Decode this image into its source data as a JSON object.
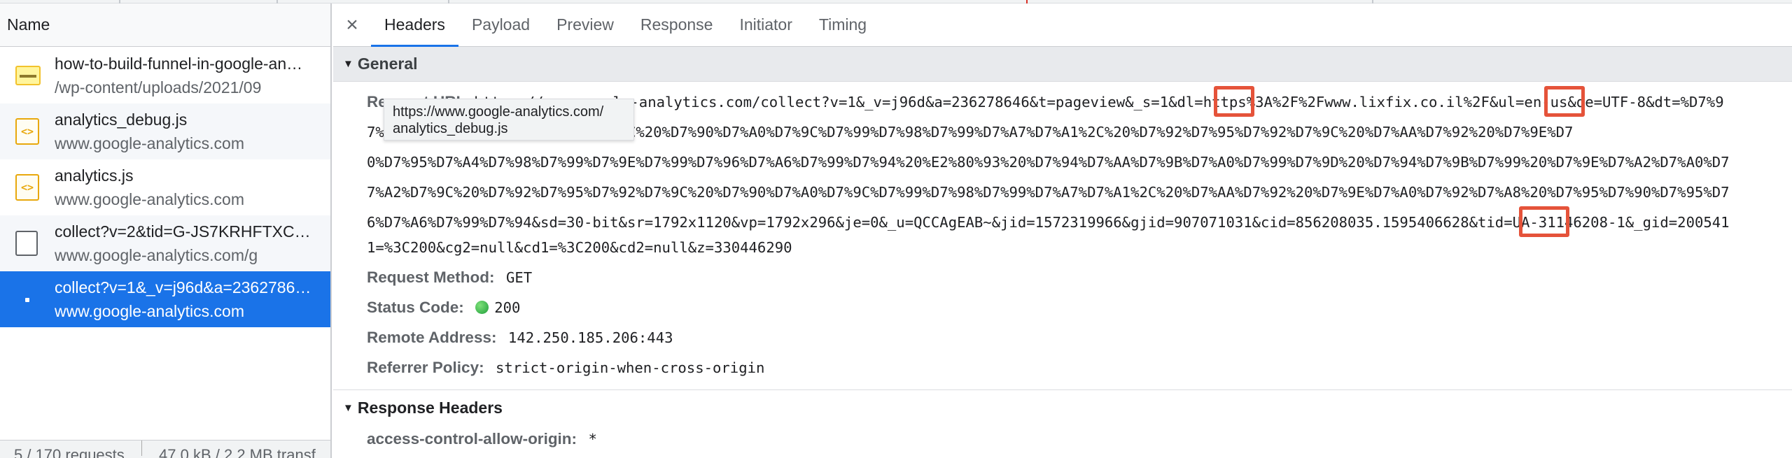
{
  "left_panel": {
    "column_header": "Name",
    "requests": [
      {
        "name": "how-to-build-funnel-in-google-an…",
        "path": "/wp-content/uploads/2021/09",
        "icon": "image-icon"
      },
      {
        "name": "analytics_debug.js",
        "path": "www.google-analytics.com",
        "icon": "script-icon"
      },
      {
        "name": "analytics.js",
        "path": "www.google-analytics.com",
        "icon": "script-icon"
      },
      {
        "name": "collect?v=2&tid=G-JS7KRHFTXC…",
        "path": "www.google-analytics.com/g",
        "icon": "document-icon"
      },
      {
        "name": "collect?v=1&_v=j96d&a=2362786…",
        "path": "www.google-analytics.com",
        "icon": "request-icon",
        "selected": true
      }
    ],
    "status": {
      "requests": "5 / 170 requests",
      "transfer": "47.0 kB / 2.2 MB transf"
    }
  },
  "tabs": {
    "items": [
      "Headers",
      "Payload",
      "Preview",
      "Response",
      "Initiator",
      "Timing"
    ],
    "active": "Headers"
  },
  "general": {
    "title": "General",
    "request_url_label": "Request URL:",
    "url_lines": [
      "https://www.google-analytics.com/collect?v=1&_v=j96d&a=236278646&t=pageview&_s=1&dl=https%3A%2F%2Fwww.lixfix.co.il%2F&ul=en-us&de=UTF-8&dt=%D7%9",
      "7%D7%95%D7%92%D7%95%D7%92%D7%9C%20%D7%90%D7%A0%D7%9C%D7%99%D7%98%D7%99%D7%A7%D7%A1%2C%20%D7%92%D7%95%D7%92%D7%9C%20%D7%AA%D7%92%20%D7%9E%D7",
      "0%D7%95%D7%A4%D7%98%D7%99%D7%9E%D7%99%D7%96%D7%A6%D7%99%D7%94%20%E2%80%93%20%D7%94%D7%AA%D7%9B%D7%A0%D7%99%D7%9D%20%D7%94%D7%9B%D7%99%20%D7%9E%D7%A2%D7%A0%D7",
      "7%A2%D7%9C%20%D7%92%D7%95%D7%92%D7%9C%20%D7%90%D7%A0%D7%9C%D7%99%D7%98%D7%99%D7%A7%D7%A1%2C%20%D7%AA%D7%92%20%D7%9E%D7%A0%D7%92%D7%A8%20%D7%95%D7%90%D7%95%D7",
      "6%D7%A6%D7%99%D7%94&sd=30-bit&sr=1792x1120&vp=1792x296&je=0&_u=QCCAgEAB~&jid=1572319966&gjid=907071031&cid=856208035.1595406628&tid=UA-31146208-1&_gid=200541",
      "1=%3C200&cg2=null&cd1=%3C200&cd2=null&z=330446290"
    ],
    "tooltip": {
      "line1": "https://www.google-analytics.com/",
      "line2": "analytics_debug.js"
    },
    "request_method_label": "Request Method:",
    "request_method": "GET",
    "status_code_label": "Status Code:",
    "status_code": "200",
    "status_color": "#1e9e3a",
    "remote_address_label": "Remote Address:",
    "remote_address": "142.250.185.206:443",
    "referrer_policy_label": "Referrer Policy:",
    "referrer_policy": "strict-origin-when-cross-origin"
  },
  "response_headers": {
    "title": "Response Headers",
    "first_label": "access-control-allow-origin:",
    "first_value": "*"
  },
  "highlight_color": "#e5533a",
  "accent_color": "#1a73e8"
}
